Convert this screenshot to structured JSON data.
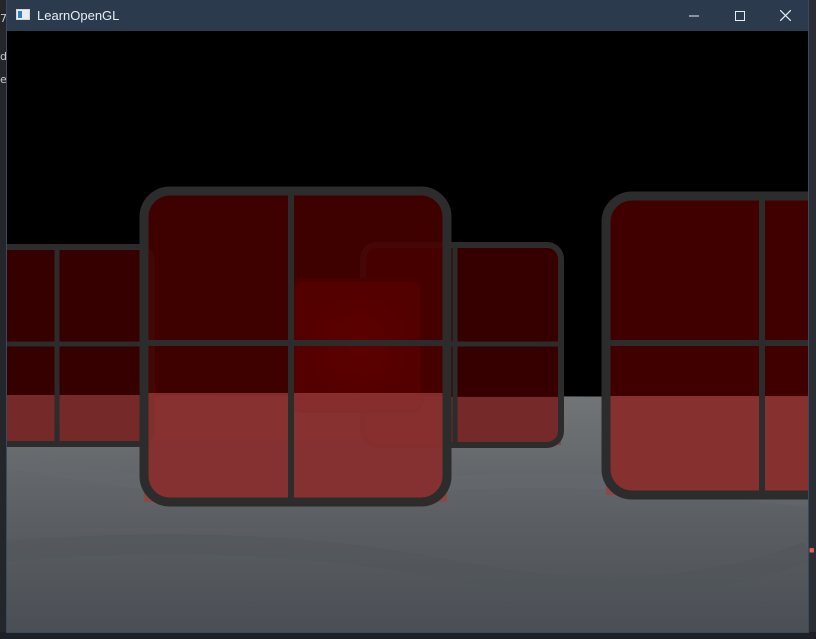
{
  "window": {
    "title": "LearnOpenGL",
    "icon": "app-window-icon",
    "controls": {
      "minimize": "minimize-icon",
      "maximize": "maximize-icon",
      "close": "close-icon"
    }
  },
  "scene": {
    "background": "#000000",
    "floor_color": "#5c6064",
    "window_tint": "#8a0000",
    "frame_color": "#2c2c2c"
  }
}
